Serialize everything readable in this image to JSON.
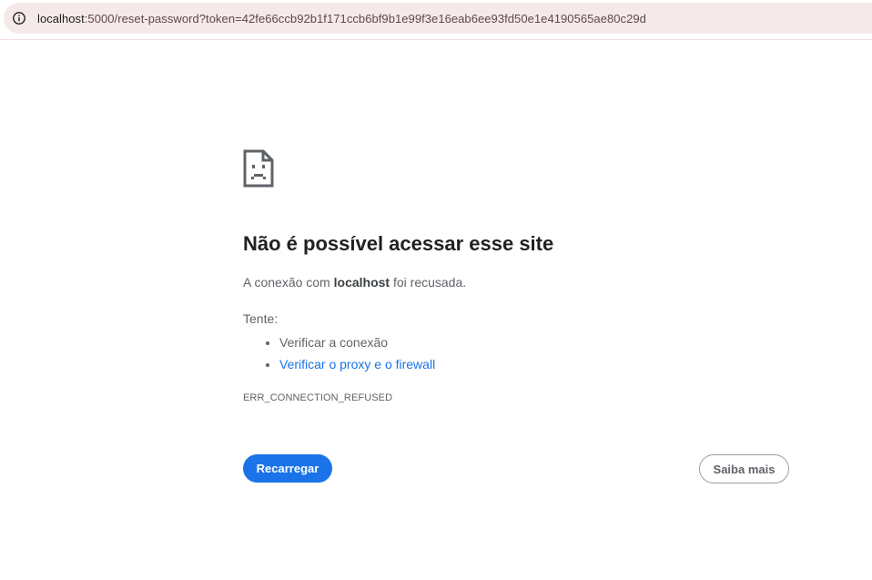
{
  "browser": {
    "url_host": "localhost",
    "url_rest": ":5000/reset-password?token=42fe66ccb92b1f171ccb6bf9b1e99f3e16eab6ee93fd50e1e4190565ae80c29d",
    "info_icon": "info-icon"
  },
  "error_page": {
    "icon": "sad-page-icon",
    "title": "Não é possível acessar esse site",
    "desc_prefix": "A conexão com ",
    "desc_host": "localhost",
    "desc_suffix": " foi recusada.",
    "try_label": "Tente:",
    "suggestions": [
      {
        "label": "Verificar a conexão",
        "link": false
      },
      {
        "label": "Verificar o proxy e o firewall",
        "link": true
      }
    ],
    "error_code": "ERR_CONNECTION_REFUSED",
    "reload_label": "Recarregar",
    "more_label": "Saiba mais"
  },
  "colors": {
    "primary": "#1a73e8",
    "omnibox_bg": "#f6e9e9",
    "text": "#202124",
    "secondary_text": "#5f6368"
  }
}
